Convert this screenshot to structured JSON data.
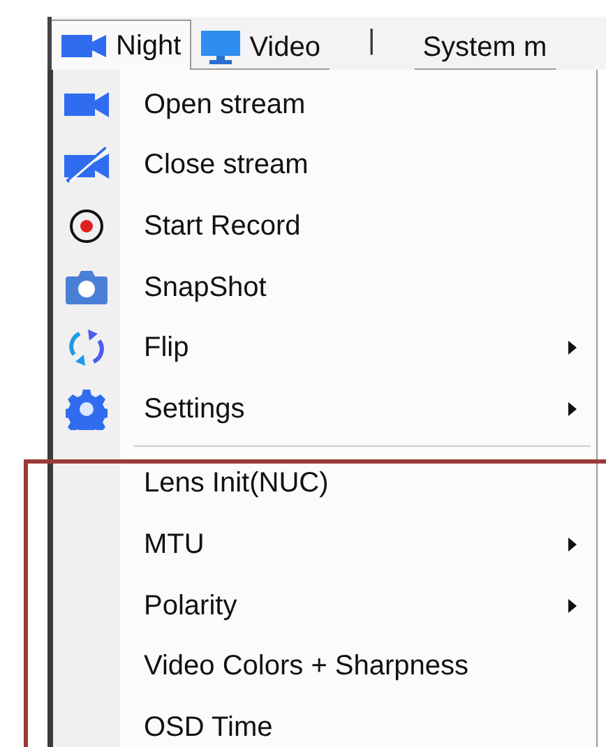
{
  "menu_bar": [
    {
      "label": "Night",
      "selected": true
    },
    {
      "label": "Video",
      "selected": false
    },
    {
      "label": "|",
      "kind": "divider"
    },
    {
      "label": "System m",
      "selected": false
    }
  ],
  "dropdown": [
    {
      "kind": "command",
      "label": "Open stream",
      "submenu": false
    },
    {
      "kind": "command",
      "label": "Close stream",
      "submenu": false
    },
    {
      "kind": "command",
      "label": "Start Record",
      "submenu": false
    },
    {
      "kind": "command",
      "label": "SnapShot",
      "submenu": false
    },
    {
      "kind": "command",
      "label": "Flip",
      "submenu": true
    },
    {
      "kind": "command",
      "label": "Settings",
      "submenu": true
    },
    {
      "kind": "separator"
    },
    {
      "kind": "command",
      "label": "Lens Init(NUC)",
      "submenu": false
    },
    {
      "kind": "command",
      "label": "MTU",
      "submenu": true
    },
    {
      "kind": "command",
      "label": "Polarity",
      "submenu": true
    },
    {
      "kind": "command",
      "label": "Video Colors + Sharpness",
      "submenu": false
    },
    {
      "kind": "command",
      "label": "OSD Time",
      "submenu": false
    }
  ]
}
